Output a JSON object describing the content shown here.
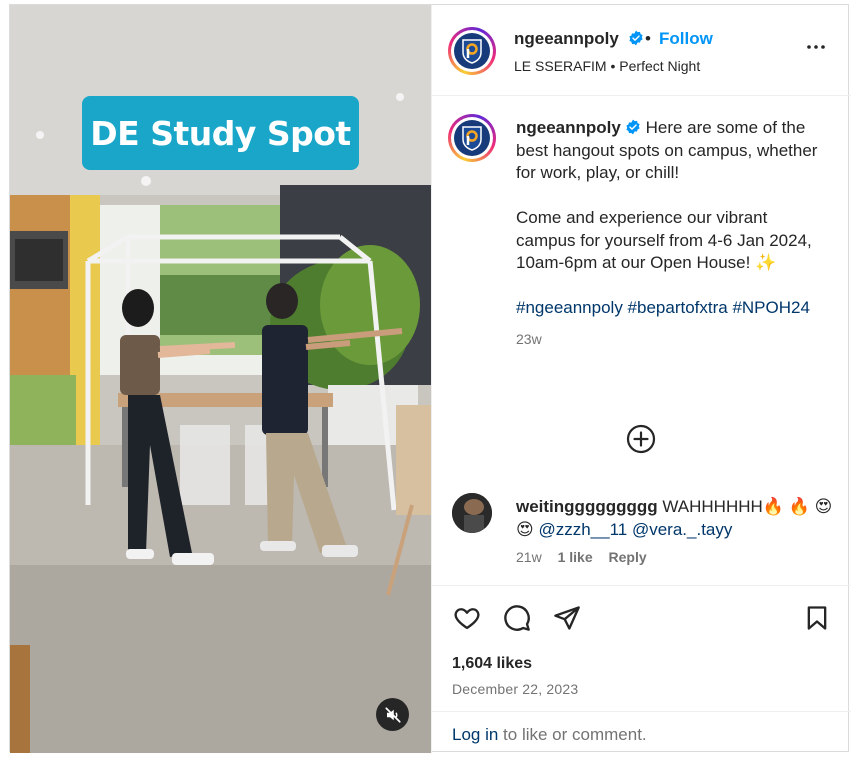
{
  "media": {
    "overlay_text": "DE Study Spot"
  },
  "header": {
    "username": "ngeeannpoly",
    "separator": "•",
    "follow_label": "Follow",
    "audio_artist": "LE SSERAFIM",
    "audio_separator": "•",
    "audio_track": "Perfect Night"
  },
  "caption": {
    "username": "ngeeannpoly",
    "text_1": "Here are some of the best hangout spots on campus, whether for work, play, or chill!",
    "text_2": "Come and experience our vibrant campus for yourself from 4-6 Jan 2024, 10am-6pm at our Open House! ✨",
    "hashtags": "#ngeeannpoly #bepartofxtra #NPOH24",
    "time": "23w"
  },
  "comment": {
    "username": "weitinggggggggg",
    "text": "WAHHHHHH🔥 🔥 😍 😍",
    "mentions": "@zzzh__11 @vera._.tayy",
    "time": "21w",
    "likes": "1 like",
    "reply_label": "Reply"
  },
  "footer": {
    "likes": "1,604 likes",
    "date": "December 22, 2023",
    "login_link": "Log in",
    "login_rest": " to like or comment."
  },
  "icons": {
    "header": [
      "verified-badge-icon",
      "more-options-icon"
    ],
    "actions": [
      "heart-icon",
      "comment-icon",
      "share-icon",
      "bookmark-icon"
    ],
    "media": [
      "muted-speaker-icon"
    ],
    "load_more": "plus-circle-icon"
  },
  "colors": {
    "accent": "#0095f6",
    "link": "#00376b",
    "overlay_bg": "#1aa6c8",
    "secondary_text": "#737373"
  }
}
